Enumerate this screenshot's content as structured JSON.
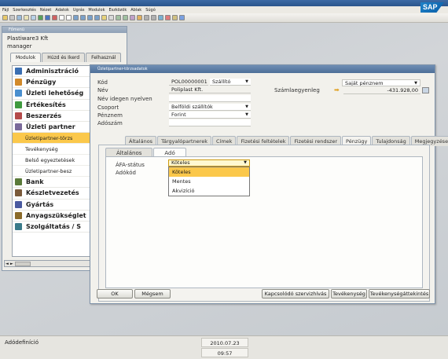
{
  "menubar": [
    "Fájl",
    "Szerkesztés",
    "Nézet",
    "Adatok",
    "Ugrás",
    "Modulok",
    "Eszközök",
    "Ablak",
    "Súgó"
  ],
  "brand": "SAP",
  "main_menu": {
    "title": "Főmenü",
    "company": "Plastiware3 Kft",
    "user": "manager",
    "tabs": [
      "Modulok",
      "Húzd és Ikerd",
      "Felhasznál"
    ],
    "items": [
      {
        "label": "Adminisztráció",
        "color": "#3b6fb2"
      },
      {
        "label": "Pénzügy",
        "color": "#d28a2a"
      },
      {
        "label": "Üzleti lehetőség",
        "color": "#4a8fcf"
      },
      {
        "label": "Értékesítés",
        "color": "#3f9a3f"
      },
      {
        "label": "Beszerzés",
        "color": "#b44a4a"
      },
      {
        "label": "Üzleti partner",
        "color": "#7a6a9a"
      }
    ],
    "subitems": [
      "Üzletipartner-törzs",
      "Tevékenység",
      "Belső egyeztetések",
      "Üzletipartner-besz"
    ],
    "items2": [
      {
        "label": "Bank",
        "color": "#5a7a3a"
      },
      {
        "label": "Készletvezetés",
        "color": "#7a5a3a"
      },
      {
        "label": "Gyártás",
        "color": "#4a5aa0"
      },
      {
        "label": "Anyagszükséglet",
        "color": "#8a6a2a"
      },
      {
        "label": "Szolgáltatás / S",
        "color": "#3a7a8a"
      }
    ]
  },
  "bp": {
    "title": "Üzletipartner-törzsadatok",
    "fields": {
      "kod_label": "Kód",
      "kod_value": "POL00000001",
      "kod_type": "Szállító",
      "nev_label": "Név",
      "nev_value": "Poliplast Kft.",
      "idegen_label": "Név idegen nyelven",
      "csoport_label": "Csoport",
      "csoport_value": "Belföldi szállítók",
      "penznem_label": "Pénznem",
      "penznem_value": "Forint",
      "adoszam_label": "Adószám",
      "currency_select": "Saját pénznem",
      "balance_label": "Számlaegyenleg",
      "balance_value": "-431.928,00"
    },
    "tabs": [
      "Általános",
      "Tárgyalópartnerek",
      "Címek",
      "Fizetési feltételek",
      "Fizetési rendszer",
      "Pénzügy",
      "Tulajdonság",
      "Megjegyzések"
    ],
    "subtabs": [
      "Általános",
      "Adó"
    ],
    "vat_label": "ÁFA-státus",
    "tax_code_label": "Adókód",
    "vat_value": "Köteles",
    "vat_options": [
      "Köteles",
      "Mentes",
      "Akvizíció"
    ],
    "buttons": {
      "ok": "OK",
      "cancel": "Mégsem",
      "connected": "Kapcsolódó szervizhívás",
      "activity": "Tevékenység",
      "activity_done": "Tevékenységáttekintés"
    }
  },
  "status": {
    "message": "Adódefiníció",
    "date": "2010.07.23",
    "time": "09:57"
  }
}
